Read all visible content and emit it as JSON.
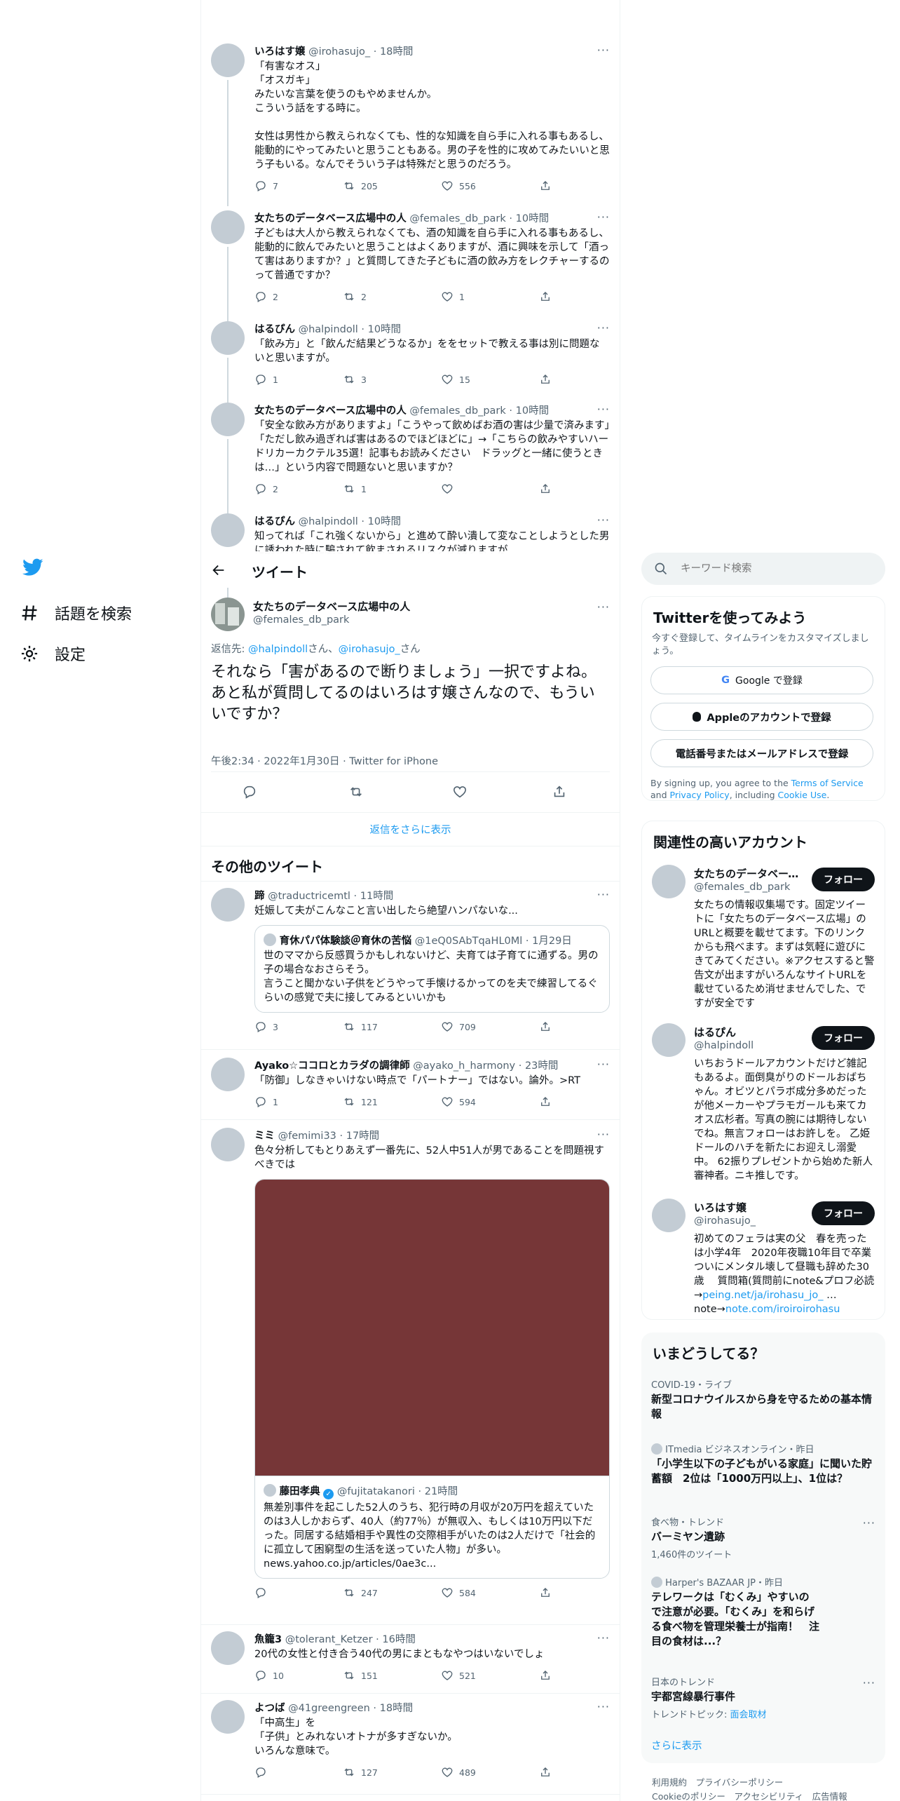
{
  "nav": {
    "search_label": "話題を検索",
    "settings_label": "設定"
  },
  "thread": [
    {
      "name": "いろはす嬢",
      "handle": "@irohasujo_",
      "time": "18時間",
      "text": "「有害なオス」\n「オスガキ」\nみたいな言葉を使うのもやめませんか。\nこういう話をする時に。\n\n女性は男性から教えられなくても、性的な知識を自ら手に入れる事もあるし、能動的にやってみたいと思うこともある。男の子を性的に攻めてみたいいと思う子もいる。なんでそういう子は特殊だと思うのだろう。",
      "replies": "7",
      "retweets": "205",
      "likes": "556"
    },
    {
      "name": "女たちのデータベース広場中の人",
      "handle": "@females_db_park",
      "time": "10時間",
      "text": "子どもは大人から教えられなくても、酒の知識を自ら手に入れる事もあるし、能動的に飲んでみたいと思うことはよくありますが、酒に興味を示して「酒って害はありますか？」と質問してきた子どもに酒の飲み方をレクチャーするのって普通ですか？",
      "replies": "2",
      "retweets": "2",
      "likes": "1"
    },
    {
      "name": "はるぴん",
      "handle": "@halpindoll",
      "time": "10時間",
      "text": "「飲み方」と「飲んだ結果どうなるか」ををセットで教える事は別に問題ないと思いますが。",
      "replies": "1",
      "retweets": "3",
      "likes": "15"
    },
    {
      "name": "女たちのデータベース広場中の人",
      "handle": "@females_db_park",
      "time": "10時間",
      "text": "「安全な飲み方がありますよ」「こうやって飲めばお酒の害は少量で済みます」「ただし飲み過ぎれば害はあるのでほどほどに」→「こちらの飲みやすいハードリカーカクテル35選！記事もお読みください　ドラッグと一緒に使うときは…」という内容で問題ないと思いますか？",
      "replies": "2",
      "retweets": "1",
      "likes": ""
    },
    {
      "name": "はるぴん",
      "handle": "@halpindoll",
      "time": "10時間",
      "text": "知ってれば「これ強くないから」と進めて酔い潰して変なことしようとした男に誘われた時に騙されて飲まされるリスクが減りますが",
      "replies": "",
      "retweets": "",
      "likes": ""
    }
  ],
  "header": {
    "title": "ツイート"
  },
  "focus": {
    "name": "女たちのデータベース広場中の人",
    "handle": "@females_db_park",
    "reply_prefix": "返信先: ",
    "reply_to_1": "@halpindoll",
    "reply_mid": "さん、",
    "reply_to_2": "@irohasujo_",
    "reply_suffix": "さん",
    "text": "それなら「害があるので断りましょう」一択ですよね。\nあと私が質問してるのはいろはす嬢さんなので、もういいですか？",
    "meta": "午後2:34 · 2022年1月30日 · Twitter for iPhone"
  },
  "show_more": "返信をさらに表示",
  "other_heading": "その他のツイート",
  "others": [
    {
      "name": "蹄",
      "handle": "@traductricemtl",
      "time": "11時間",
      "text": "妊娠して夫がこんなこと言い出したら絶望ハンパないな...",
      "quote": {
        "name": "育休パパ体験談＠育休の苦悩",
        "handle": "@1eQ0SAbTqaHL0Ml",
        "time": "1月29日",
        "text": "世のママから反感買うかもしれないけど、夫育ては子育てに通ずる。男の子の場合なおさらそう。\n言うこと聞かない子供をどうやって手懐けるかってのを夫で練習してるぐらいの感覚で夫に接してみるといいかも"
      },
      "replies": "3",
      "retweets": "117",
      "likes": "709"
    },
    {
      "name": "Ayako☆ココロとカラダの調律師",
      "handle": "@ayako_h_harmony",
      "time": "23時間",
      "text": "「防御」しなきゃいけない時点で「パートナー」ではない。論外。>RT",
      "replies": "1",
      "retweets": "121",
      "likes": "594"
    },
    {
      "name": "ミミ",
      "handle": "@femimi33",
      "time": "17時間",
      "text": "色々分析してもとりあえず一番先に、52人中51人が男であることを問題視すべきでは",
      "quote": {
        "name": "藤田孝典",
        "handle": "@fujitatakanori",
        "time": "21時間",
        "text": "無差別事件を起こした52人のうち、犯行時の月収が20万円を超えていたのは3人しかおらず、40人（約77％）が無収入、もしくは10万円以下だった。同居する結婚相手や異性の交際相手がいたのは2人だけで「社会的に孤立して困窮型の生活を送っていた人物」が多い。\nnews.yahoo.co.jp/articles/0ae3c..."
      },
      "replies": "",
      "retweets": "247",
      "likes": "584"
    },
    {
      "name": "魚籠3",
      "handle": "@tolerant_Ketzer",
      "time": "16時間",
      "text": "20代の女性と付き合う40代の男にまともなやつはいないでしょ",
      "replies": "10",
      "retweets": "151",
      "likes": "521"
    },
    {
      "name": "よつば",
      "handle": "@41greengreen",
      "time": "18時間",
      "text": "「中高生」を\n「子供」とみれないオトナが多すぎないか。\nいろんな意味で。",
      "replies": "",
      "retweets": "127",
      "likes": "489"
    }
  ],
  "search": {
    "placeholder": "キーワード検索"
  },
  "signup": {
    "title": "Twitterを使ってみよう",
    "desc": "今すぐ登録して、タイムラインをカスタマイズしましょう。",
    "google": "Google で登録",
    "apple": "Appleのアカウントで登録",
    "phone": "電話番号またはメールアドレスで登録",
    "legal_1": "By signing up, you agree to the ",
    "terms": "Terms of Service",
    "legal_2": " and ",
    "privacy": "Privacy Policy",
    "legal_3": ", including ",
    "cookie": "Cookie Use",
    "legal_4": "."
  },
  "relevant": {
    "title": "関連性の高いアカウント",
    "follow": "フォロー",
    "accounts": [
      {
        "name": "女たちのデータベース広場",
        "handle": "@females_db_park",
        "bio": "女たちの情報収集場です。固定ツイートに「女たちのデータベース広場」のURLと概要を載せてます。下のリンクからも飛べます。まずは気軽に遊びにきてみてください。※アクセスすると警告文が出ますがいろんなサイトURLを載せているため消せませんでした、ですが安全です"
      },
      {
        "name": "はるぴん",
        "handle": "@halpindoll",
        "bio": "いちおうドールアカウントだけど雑記もあるよ。面倒臭がりのドールおばちゃん。オビツとパラボ成分多めだったが他メーカーやプラモガールも来てカオス広杉者。写真の腕には期待しないでね。無言フォローはお許しを。 乙姫ドールのハチを新たにお迎えし溺愛中。 62振りプレゼントから始めた新人審神者。ニキ推しです。"
      },
      {
        "name": "いろはす嬢",
        "handle": "@irohasujo_",
        "bio": "初めてのフェラは実の父　春を売ったは小学4年　2020年夜職10年目で卒業　ついにメンタル壊して昼職も辞めた30歳　 質問箱(質問前にnote&プロフ必読→",
        "link1": "peing.net/ja/irohasu_jo_",
        "bio2": "…note→",
        "link2": "note.com/iroiroirohasu"
      }
    ]
  },
  "trends": {
    "title": "いまどうしてる？",
    "items": [
      {
        "cat": "COVID-19・ライブ",
        "title": "新型コロナウイルスから身を守るための基本情報",
        "sub": ""
      },
      {
        "cat": "ITmedia ビジネスオンライン・昨日",
        "title": "「小学生以下の子どもがいる家庭」に聞いた貯蓄額　2位は「1000万円以上」、1位は？",
        "sub": ""
      },
      {
        "cat": "食べ物・トレンド",
        "title": "バーミヤン遺跡",
        "sub": "1,460件のツイート"
      },
      {
        "cat": "Harper's BAZAAR JP・昨日",
        "title": "テレワークは「むくみ」やすいので注意が必要。「むくみ」を和らげる食べ物を管理栄養士が指南！　注目の食材は...？",
        "sub": ""
      },
      {
        "cat": "日本のトレンド",
        "title": "宇都宮線暴行事件",
        "sub_prefix": "トレンドトピック: ",
        "sub_link": "面会取材"
      }
    ],
    "more": "さらに表示"
  },
  "footer": {
    "l1": "利用規約",
    "l2": "プライバシーポリシー",
    "l3": "Cookieのポリシー",
    "l4": "アクセシビリティ",
    "l5": "広告情報"
  }
}
